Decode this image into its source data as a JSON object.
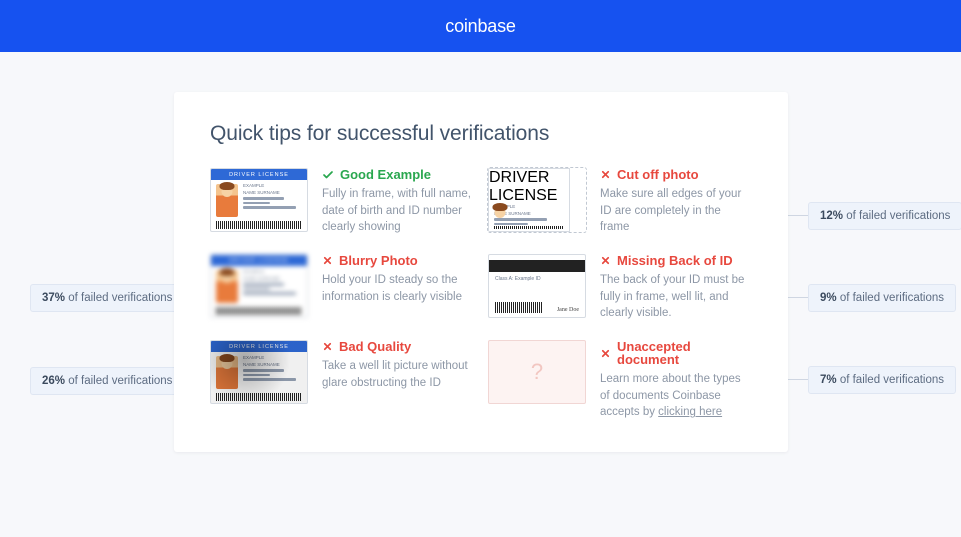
{
  "header": {
    "brand": "coinbase"
  },
  "card": {
    "heading": "Quick tips for successful verifications"
  },
  "idcard": {
    "stripe_label": "DRIVER LICENSE",
    "field1": "EXAMPLE",
    "field2": "NAME SURNAME"
  },
  "backcard": {
    "class_line": "Class A: Example ID",
    "signature": "Jane Doe"
  },
  "tiles": {
    "good": {
      "title": "Good Example",
      "desc": "Fully in frame, with full name, date of birth and ID number clearly showing"
    },
    "cutoff": {
      "title": "Cut off photo",
      "desc": "Make sure all edges of your ID are completely in the frame"
    },
    "blurry": {
      "title": "Blurry Photo",
      "desc": "Hold your ID steady so the information is clearly visible"
    },
    "missing": {
      "title": "Missing Back of ID",
      "desc": "The back of your ID must be fully in frame, well lit, and clearly visible."
    },
    "bad": {
      "title": "Bad Quality",
      "desc": "Take a well lit picture without glare obstructing the ID"
    },
    "unaccepted": {
      "title": "Unaccepted document",
      "desc_prefix": "Learn more about the types of documents Coinbase accepts by ",
      "link": "clicking here"
    }
  },
  "callouts": {
    "cutoff": {
      "pct": "12%",
      "suffix": " of failed verifications"
    },
    "blurry": {
      "pct": "37%",
      "suffix": " of failed verifications"
    },
    "missing": {
      "pct": "9%",
      "suffix": " of failed verifications"
    },
    "bad": {
      "pct": "26%",
      "suffix": " of failed verifications"
    },
    "unaccepted": {
      "pct": "7%",
      "suffix": " of failed verifications"
    }
  },
  "placeholder_glyph": "?"
}
